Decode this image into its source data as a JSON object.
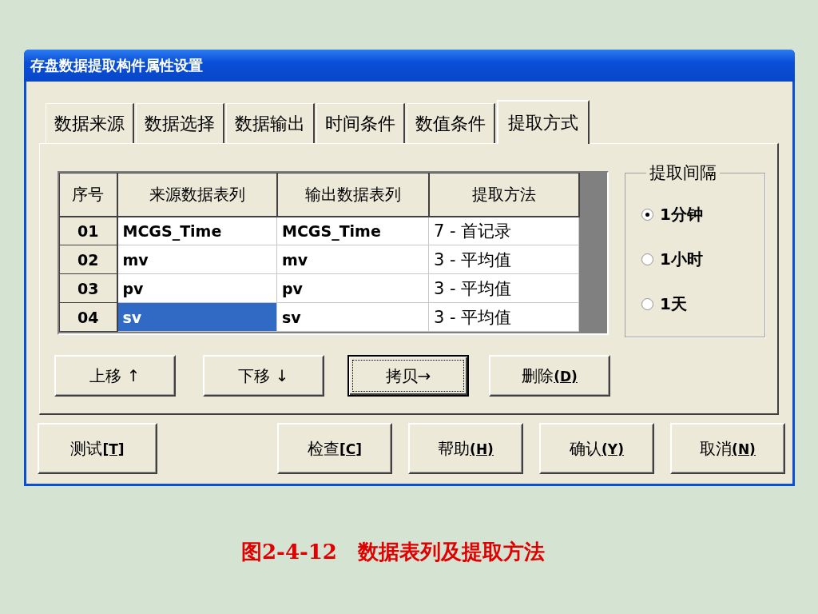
{
  "window": {
    "title": "存盘数据提取构件属性设置"
  },
  "tabs": [
    {
      "label": "数据来源",
      "selected": false
    },
    {
      "label": "数据选择",
      "selected": false
    },
    {
      "label": "数据输出",
      "selected": false
    },
    {
      "label": "时间条件",
      "selected": false
    },
    {
      "label": "数值条件",
      "selected": false
    },
    {
      "label": "提取方式",
      "selected": true
    }
  ],
  "table": {
    "columns": [
      "序号",
      "来源数据表列",
      "输出数据表列",
      "提取方法"
    ],
    "rows": [
      {
        "cells": [
          {
            "kind": "index",
            "text": "01",
            "selected": false
          },
          {
            "kind": "name",
            "text": "MCGS_Time",
            "selected": false
          },
          {
            "kind": "name",
            "text": "MCGS_Time",
            "selected": false
          },
          {
            "kind": "method",
            "text": "7 - 首记录",
            "selected": false
          }
        ]
      },
      {
        "cells": [
          {
            "kind": "index",
            "text": "02",
            "selected": false
          },
          {
            "kind": "name",
            "text": "mv",
            "selected": false
          },
          {
            "kind": "name",
            "text": "mv",
            "selected": false
          },
          {
            "kind": "method",
            "text": "3 - 平均值",
            "selected": false
          }
        ]
      },
      {
        "cells": [
          {
            "kind": "index",
            "text": "03",
            "selected": false
          },
          {
            "kind": "name",
            "text": "pv",
            "selected": false
          },
          {
            "kind": "name",
            "text": "pv",
            "selected": false
          },
          {
            "kind": "method",
            "text": "3 - 平均值",
            "selected": false
          }
        ]
      },
      {
        "cells": [
          {
            "kind": "index",
            "text": "04",
            "selected": false
          },
          {
            "kind": "name",
            "text": "sv",
            "selected": true
          },
          {
            "kind": "name",
            "text": "sv",
            "selected": false
          },
          {
            "kind": "method",
            "text": "3 - 平均值",
            "selected": false
          }
        ]
      }
    ]
  },
  "interval_group": {
    "title": "提取间隔",
    "options": [
      {
        "label": "1分钟",
        "selected": true
      },
      {
        "label": "1小时",
        "selected": false
      },
      {
        "label": "1天",
        "selected": false
      }
    ]
  },
  "row_buttons": [
    {
      "label": "上移 ↑",
      "focused": false
    },
    {
      "label": "下移 ↓",
      "focused": false
    },
    {
      "label": "拷贝→",
      "focused": true
    },
    {
      "label": "删除**(D)**",
      "focused": false
    }
  ],
  "dialog_buttons": [
    {
      "label": "测试**[T]**",
      "focused": false
    },
    {
      "label": "检查**[C]**",
      "focused": false
    },
    {
      "label": "帮助**(H)**",
      "focused": false
    },
    {
      "label": "确认**(Y)**",
      "focused": false
    },
    {
      "label": "取消**(N)**",
      "focused": false
    }
  ],
  "caption": "图2-4-12　数据表列及提取方法"
}
